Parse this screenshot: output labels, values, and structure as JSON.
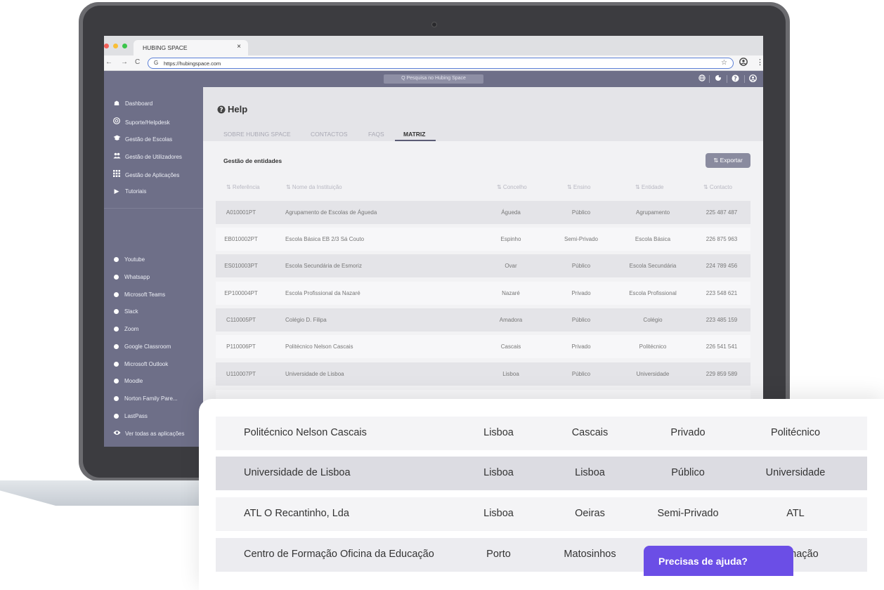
{
  "browser": {
    "tab_title": "HUBING SPACE",
    "tab_close": "×",
    "url": "https://hubingspace.com",
    "back": "←",
    "forward": "→",
    "reload": "C",
    "star": "☆",
    "menu": "⋮"
  },
  "appbar": {
    "search_placeholder": "Q  Pesquisa no Hubing Space"
  },
  "sidebar": {
    "items": [
      {
        "label": "Dashboard",
        "icon": "home-icon"
      },
      {
        "label": "Suporte/Helpdesk",
        "icon": "lifebuoy-icon"
      },
      {
        "label": "Gestão de Escolas",
        "icon": "graduation-cap-icon"
      },
      {
        "label": "Gestão de Utilizadores",
        "icon": "users-icon"
      },
      {
        "label": "Gestão de Aplicações",
        "icon": "grid-icon"
      },
      {
        "label": "Tutoriais",
        "icon": "play-icon"
      }
    ],
    "apps": [
      "Youtube",
      "Whatsapp",
      "Microsoft Teams",
      "Slack",
      "Zoom",
      "Google Classroom",
      "Microsoft Outlook",
      "Moodle",
      "Norton Family Pare...",
      "LastPass"
    ],
    "view_all": "Ver todas as aplicações"
  },
  "page": {
    "title": "Help",
    "tabs": [
      "SOBRE HUBING SPACE",
      "CONTACTOS",
      "FAQS",
      "MATRIZ"
    ],
    "active_tab": "MATRIZ",
    "section_title": "Gestão de entidades",
    "export_label": "⇅ Exportar"
  },
  "table": {
    "headers": [
      "⇅ Referência",
      "⇅ Nome da Instituição",
      "⇅ Concelho",
      "⇅ Ensino",
      "⇅ Entidade",
      "⇅ Contacto"
    ],
    "rows": [
      [
        "A010001PT",
        "Agrupamento de Escolas de Águeda",
        "Águeda",
        "Público",
        "Agrupamento",
        "225 487 487"
      ],
      [
        "EB010002PT",
        "Escola Básica EB 2/3 Sá Couto",
        "Espinho",
        "Semi-Privado",
        "Escola Básica",
        "226 875 963"
      ],
      [
        "ES010003PT",
        "Escola Secundária de Esmoriz",
        "Ovar",
        "Público",
        "Escola Secundária",
        "224 789 456"
      ],
      [
        "EP100004PT",
        "Escola Profissional da Nazaré",
        "Nazaré",
        "Privado",
        "Escola Profissional",
        "223 548 621"
      ],
      [
        "C110005PT",
        "Colégio D. Filipa",
        "Amadora",
        "Público",
        "Colégio",
        "223 485 159"
      ],
      [
        "P110006PT",
        "Politécnico Nelson Cascais",
        "Cascais",
        "Privado",
        "Politécnico",
        "226 541 541"
      ],
      [
        "U110007PT",
        "Universidade de Lisboa",
        "Lisboa",
        "Público",
        "Universidade",
        "229 859 589"
      ]
    ]
  },
  "overlay": {
    "rows": [
      [
        "Politécnico Nelson Cascais",
        "Lisboa",
        "Cascais",
        "Privado",
        "Politécnico"
      ],
      [
        "Universidade de Lisboa",
        "Lisboa",
        "Lisboa",
        "Público",
        "Universidade"
      ],
      [
        "ATL O Recantinho, Lda",
        "Lisboa",
        "Oeiras",
        "Semi-Privado",
        "ATL"
      ],
      [
        "Centro de Formação Oficina da Educação",
        "Porto",
        "Matosinhos",
        "",
        "Formação"
      ]
    ]
  },
  "help_button": "Precisas de ajuda?",
  "colors": {
    "sidebar": "#6e6f88",
    "accent": "#6b4ee6",
    "export_button": "#8a8b9f"
  }
}
